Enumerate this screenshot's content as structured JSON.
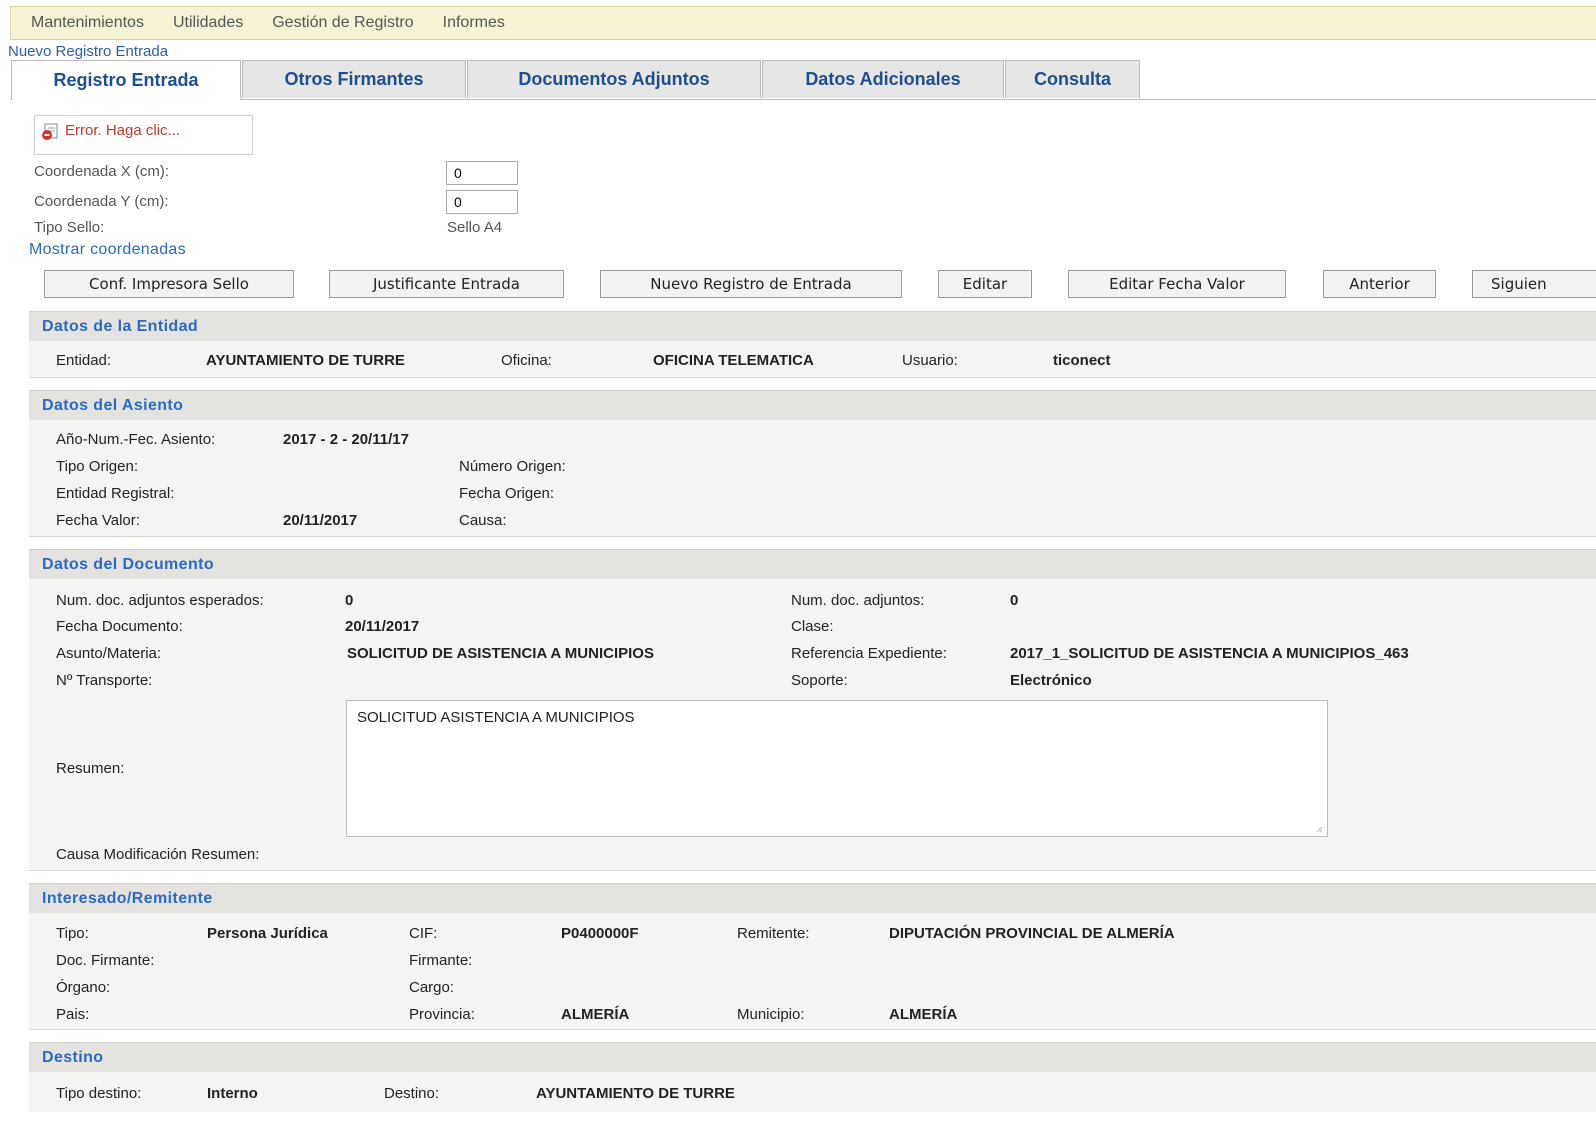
{
  "menu": {
    "items": [
      "Mantenimientos",
      "Utilidades",
      "Gestión de Registro",
      "Informes"
    ]
  },
  "breadcrumb": "Nuevo Registro Entrada",
  "tabs": [
    "Registro Entrada",
    "Otros Firmantes",
    "Documentos Adjuntos",
    "Datos Adicionales",
    "Consulta"
  ],
  "active_tab": "Registro Entrada",
  "error_box": {
    "icon": "error-document-icon",
    "text": "Error. Haga clic..."
  },
  "sello": {
    "coord_x_label": "Coordenada X (cm):",
    "coord_x_value": "0",
    "coord_y_label": "Coordenada Y (cm):",
    "coord_y_value": "0",
    "tipo_label": "Tipo Sello:",
    "tipo_value": "Sello A4",
    "show_coords_link": "Mostrar coordenadas"
  },
  "buttons": [
    "Conf. Impresora Sello",
    "Justificante Entrada",
    "Nuevo Registro de Entrada",
    "Editar",
    "Editar Fecha Valor",
    "Anterior",
    "Siguien"
  ],
  "entidad": {
    "title": "Datos de la Entidad",
    "entidad_label": "Entidad:",
    "entidad_value": "AYUNTAMIENTO DE TURRE",
    "oficina_label": "Oficina:",
    "oficina_value": "OFICINA TELEMATICA",
    "usuario_label": "Usuario:",
    "usuario_value": "ticonect"
  },
  "asiento": {
    "title": "Datos del Asiento",
    "anio_label": "Año-Num.-Fec. Asiento:",
    "anio_value": "2017 - 2 - 20/11/17",
    "tipo_origen_label": "Tipo Origen:",
    "numero_origen_label": "Número Origen:",
    "entidad_registral_label": "Entidad Registral:",
    "fecha_origen_label": "Fecha Origen:",
    "fecha_valor_label": "Fecha Valor:",
    "fecha_valor_value": "20/11/2017",
    "causa_label": "Causa:"
  },
  "documento": {
    "title": "Datos del Documento",
    "num_esperados_label": "Num. doc. adjuntos esperados:",
    "num_esperados_value": "0",
    "num_adjuntos_label": "Num. doc. adjuntos:",
    "num_adjuntos_value": "0",
    "fecha_label": "Fecha Documento:",
    "fecha_value": "20/11/2017",
    "clase_label": "Clase:",
    "asunto_label": "Asunto/Materia:",
    "asunto_value": "SOLICITUD DE ASISTENCIA A MUNICIPIOS",
    "ref_label": "Referencia Expediente:",
    "ref_value": "2017_1_SOLICITUD DE ASISTENCIA A MUNICIPIOS_463",
    "transporte_label": "Nº Transporte:",
    "soporte_label": "Soporte:",
    "soporte_value": "Electrónico",
    "resumen_label": "Resumen:",
    "resumen_value": "SOLICITUD ASISTENCIA A MUNICIPIOS",
    "causa_mod_label": "Causa Modificación Resumen:"
  },
  "interesado": {
    "title": "Interesado/Remitente",
    "tipo_label": "Tipo:",
    "tipo_value": "Persona Jurídica",
    "cif_label": "CIF:",
    "cif_value": "P0400000F",
    "remitente_label": "Remitente:",
    "remitente_value": "DIPUTACIÓN PROVINCIAL DE ALMERÍA",
    "doc_firmante_label": "Doc. Firmante:",
    "firmante_label": "Firmante:",
    "organo_label": "Órgano:",
    "cargo_label": "Cargo:",
    "pais_label": "Pais:",
    "provincia_label": "Provincia:",
    "provincia_value": "ALMERÍA",
    "municipio_label": "Municipio:",
    "municipio_value": "ALMERÍA"
  },
  "destino": {
    "title": "Destino",
    "tipo_label": "Tipo destino:",
    "tipo_value": "Interno",
    "destino_label": "Destino:",
    "destino_value": "AYUNTAMIENTO DE TURRE"
  }
}
